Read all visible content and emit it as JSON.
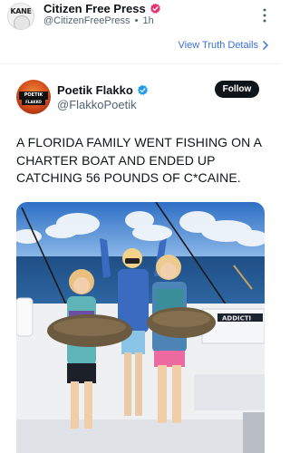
{
  "post": {
    "author": "Citizen Free Press",
    "handle": "@CitizenFreePress",
    "separator": "•",
    "time": "1h",
    "avatar_text": "KANE",
    "view_details": "View Truth Details"
  },
  "quote": {
    "author": "Poetik Flakko",
    "handle": "@FlakkoPoetik",
    "follow_label": "Follow",
    "text": "A FLORIDA FAMILY WENT FISHING ON A CHARTER BOAT AND ENDED UP CATCHING 56 POUNDS OF C*CAINE.",
    "avatar_text_top": "POETIK",
    "avatar_text_bottom": "FLAKKO",
    "photo_boat_text": "ADDICTI"
  },
  "icons": {
    "verified_pink": "verified-badge-icon",
    "verified_blue": "verified-badge-icon",
    "more": "more-vertical-icon",
    "chevron": "chevron-right-icon"
  },
  "colors": {
    "link": "#3b6fd9",
    "verified_pink": "#e5366f",
    "verified_blue": "#1d9bf0",
    "follow_bg": "#0f1419"
  }
}
